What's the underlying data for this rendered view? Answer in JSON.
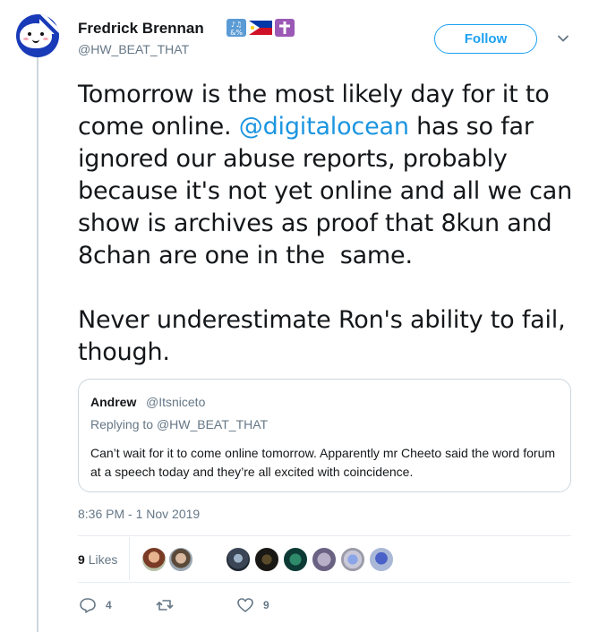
{
  "author": {
    "name": "Fredrick Brennan",
    "handle": "@HW_BEAT_THAT"
  },
  "follow_label": "Follow",
  "tweet": {
    "line1": "Tomorrow is the most likely day for it to",
    "line2a": "come online. ",
    "mention": "@digitalocean",
    "line2b": " has so far",
    "rest": "ignored our abuse reports, probably\nbecause it's not yet online and all we can\nshow is archives as proof that 8kun and\n8chan are one in the  same.\n\nNever underestimate Ron's ability to fail,\nthough."
  },
  "quote": {
    "name": "Andrew",
    "handle": "@Itsniceto",
    "replying_prefix": "Replying to ",
    "replying_handle": "@HW_BEAT_THAT",
    "text": "Can’t wait for it to come online tomorrow. Apparently mr Cheeto said the word forum at a speech today and they’re all excited with coincidence."
  },
  "timestamp": "8:36 PM - 1 Nov 2019",
  "likes": {
    "count": "9",
    "label": "Likes"
  },
  "actions": {
    "reply_count": "4",
    "retweet_count": "",
    "like_count": "9"
  },
  "colors": {
    "accent": "#1da1f2",
    "mention": "#1b95e0",
    "muted": "#657786",
    "border": "#ccd6dd"
  }
}
